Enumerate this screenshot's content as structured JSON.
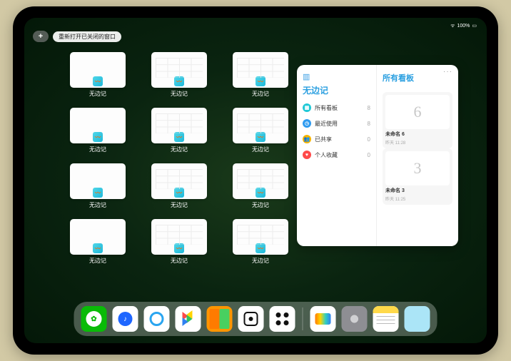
{
  "status": {
    "wifi": "􀙇",
    "battery_pct": "100%"
  },
  "plus_label": "+",
  "reopen_label": "重新打开已关闭的窗口",
  "app_name": "无边记",
  "thumbs": [
    {
      "label": "无边记",
      "variant": "blank"
    },
    {
      "label": "无边记",
      "variant": "grid"
    },
    {
      "label": "无边记",
      "variant": "grid"
    },
    {
      "label": "无边记",
      "variant": "blank"
    },
    {
      "label": "无边记",
      "variant": "grid"
    },
    {
      "label": "无边记",
      "variant": "grid"
    },
    {
      "label": "无边记",
      "variant": "blank"
    },
    {
      "label": "无边记",
      "variant": "grid"
    },
    {
      "label": "无边记",
      "variant": "grid"
    },
    {
      "label": "无边记",
      "variant": "blank"
    },
    {
      "label": "无边记",
      "variant": "grid"
    },
    {
      "label": "无边记",
      "variant": "grid"
    }
  ],
  "panel": {
    "left_title": "无边记",
    "more": "···",
    "categories": [
      {
        "icon": "all",
        "label": "所有看板",
        "count": "8"
      },
      {
        "icon": "recent",
        "label": "最近使用",
        "count": "8"
      },
      {
        "icon": "shared",
        "label": "已共享",
        "count": "0"
      },
      {
        "icon": "fav",
        "label": "个人收藏",
        "count": "0"
      }
    ],
    "right_title": "所有看板",
    "boards": [
      {
        "glyph": "6",
        "name": "未命名 6",
        "sub": "昨天 11:28"
      },
      {
        "glyph": "3",
        "name": "未命名 3",
        "sub": "昨天 11:25"
      }
    ]
  },
  "dock": {
    "apps": [
      {
        "key": "wechat",
        "name": "wechat-icon"
      },
      {
        "key": "qqmusic",
        "name": "music-icon"
      },
      {
        "key": "qq",
        "name": "qq-browser-icon"
      },
      {
        "key": "play",
        "name": "play-store-icon"
      },
      {
        "key": "books",
        "name": "books-icon"
      },
      {
        "key": "wb",
        "name": "whiteboard-app-icon"
      },
      {
        "key": "dots",
        "name": "camera-app-icon"
      }
    ],
    "recents": [
      {
        "key": "freeform",
        "name": "freeform-icon"
      },
      {
        "key": "settings",
        "name": "settings-icon"
      },
      {
        "key": "notes",
        "name": "notes-icon"
      },
      {
        "key": "folder",
        "name": "app-folder-icon"
      }
    ]
  }
}
